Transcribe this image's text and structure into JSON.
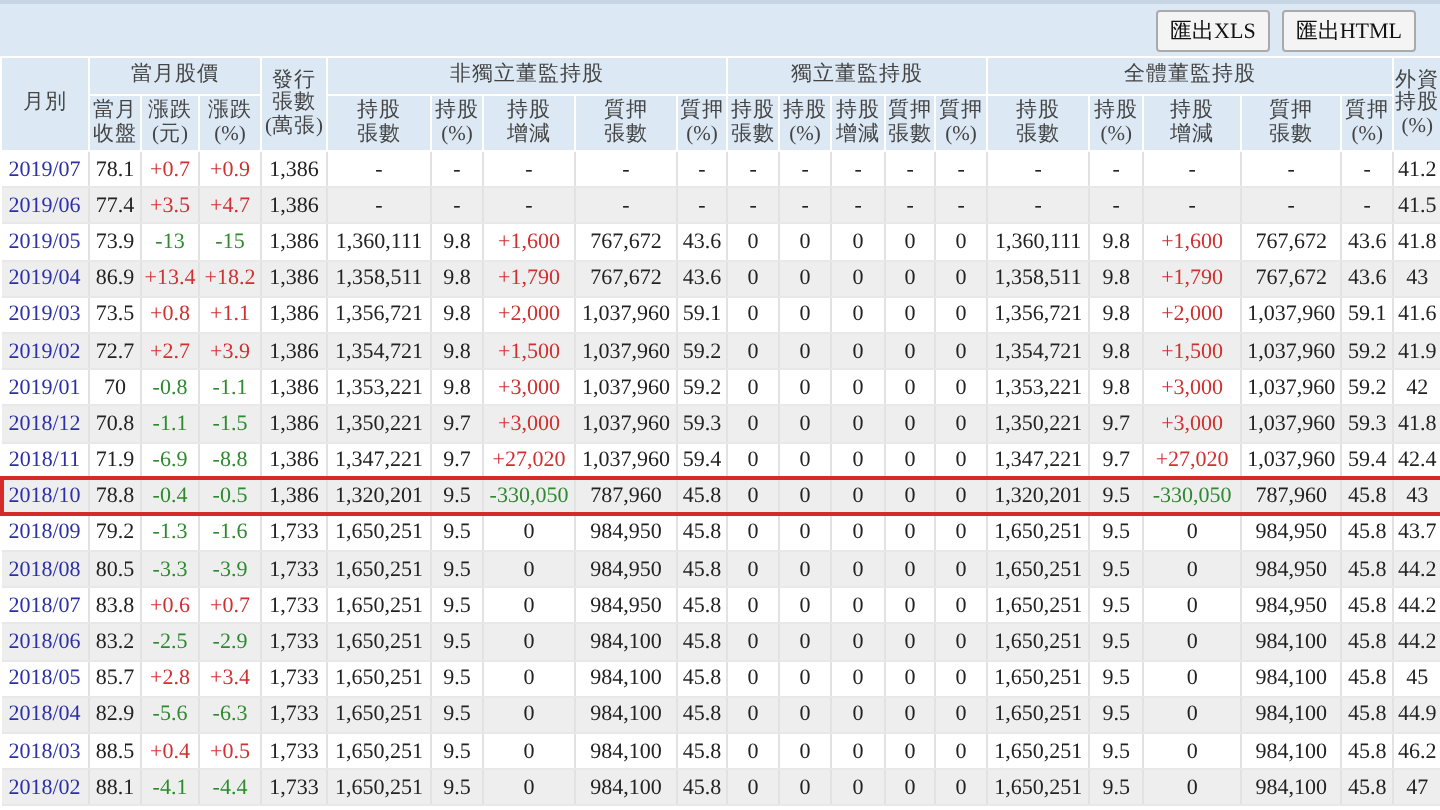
{
  "toolbar": {
    "buttons": [
      "匯出XLS",
      "匯出HTML"
    ]
  },
  "header": [
    {
      "kind": "single",
      "label": "月別"
    },
    {
      "kind": "group",
      "label": "當月股價",
      "columns": [
        "當月收盤",
        "漲跌(元)",
        "漲跌(%)"
      ]
    },
    {
      "kind": "single",
      "label": "發行張數(萬張)"
    },
    {
      "kind": "group",
      "label": "非獨立董監持股",
      "columns": [
        "持股張數",
        "持股(%)",
        "持股增減",
        "質押張數",
        "質押(%)"
      ]
    },
    {
      "kind": "group",
      "label": "獨立董監持股",
      "columns": [
        "持股張數",
        "持股(%)",
        "持股增減",
        "質押張數",
        "質押(%)"
      ]
    },
    {
      "kind": "group",
      "label": "全體董監持股",
      "columns": [
        "持股張數",
        "持股(%)",
        "持股增減",
        "質押張數",
        "質押(%)"
      ]
    },
    {
      "kind": "single",
      "label": "外資持股(%)"
    }
  ],
  "rows": [
    {
      "month": "2019/07",
      "price_rise": true,
      "holding_rise": false,
      "holding_fall": false,
      "highlighted": false,
      "cells": [
        "78.1",
        "+0.7",
        "+0.9",
        "1,386",
        "-",
        "-",
        "-",
        "-",
        "-",
        "-",
        "-",
        "-",
        "-",
        "-",
        "-",
        "-",
        "-",
        "-",
        "-",
        "41.2"
      ]
    },
    {
      "month": "2019/06",
      "price_rise": true,
      "holding_rise": false,
      "holding_fall": false,
      "highlighted": false,
      "cells": [
        "77.4",
        "+3.5",
        "+4.7",
        "1,386",
        "-",
        "-",
        "-",
        "-",
        "-",
        "-",
        "-",
        "-",
        "-",
        "-",
        "-",
        "-",
        "-",
        "-",
        "-",
        "41.5"
      ]
    },
    {
      "month": "2019/05",
      "price_rise": false,
      "holding_rise": true,
      "highlighted": false,
      "cells": [
        "73.9",
        "-13",
        "-15",
        "1,386",
        "1,360,111",
        "9.8",
        "+1,600",
        "767,672",
        "43.6",
        "0",
        "0",
        "0",
        "0",
        "0",
        "1,360,111",
        "9.8",
        "+1,600",
        "767,672",
        "43.6",
        "41.8"
      ]
    },
    {
      "month": "2019/04",
      "price_rise": true,
      "holding_rise": true,
      "highlighted": false,
      "cells": [
        "86.9",
        "+13.4",
        "+18.2",
        "1,386",
        "1,358,511",
        "9.8",
        "+1,790",
        "767,672",
        "43.6",
        "0",
        "0",
        "0",
        "0",
        "0",
        "1,358,511",
        "9.8",
        "+1,790",
        "767,672",
        "43.6",
        "43"
      ]
    },
    {
      "month": "2019/03",
      "price_rise": true,
      "holding_rise": true,
      "highlighted": false,
      "cells": [
        "73.5",
        "+0.8",
        "+1.1",
        "1,386",
        "1,356,721",
        "9.8",
        "+2,000",
        "1,037,960",
        "59.1",
        "0",
        "0",
        "0",
        "0",
        "0",
        "1,356,721",
        "9.8",
        "+2,000",
        "1,037,960",
        "59.1",
        "41.6"
      ]
    },
    {
      "month": "2019/02",
      "price_rise": true,
      "holding_rise": true,
      "highlighted": false,
      "cells": [
        "72.7",
        "+2.7",
        "+3.9",
        "1,386",
        "1,354,721",
        "9.8",
        "+1,500",
        "1,037,960",
        "59.2",
        "0",
        "0",
        "0",
        "0",
        "0",
        "1,354,721",
        "9.8",
        "+1,500",
        "1,037,960",
        "59.2",
        "41.9"
      ]
    },
    {
      "month": "2019/01",
      "price_rise": false,
      "holding_rise": true,
      "highlighted": false,
      "cells": [
        "70",
        "-0.8",
        "-1.1",
        "1,386",
        "1,353,221",
        "9.8",
        "+3,000",
        "1,037,960",
        "59.2",
        "0",
        "0",
        "0",
        "0",
        "0",
        "1,353,221",
        "9.8",
        "+3,000",
        "1,037,960",
        "59.2",
        "42"
      ]
    },
    {
      "month": "2018/12",
      "price_rise": false,
      "holding_rise": true,
      "highlighted": false,
      "cells": [
        "70.8",
        "-1.1",
        "-1.5",
        "1,386",
        "1,350,221",
        "9.7",
        "+3,000",
        "1,037,960",
        "59.3",
        "0",
        "0",
        "0",
        "0",
        "0",
        "1,350,221",
        "9.7",
        "+3,000",
        "1,037,960",
        "59.3",
        "41.8"
      ]
    },
    {
      "month": "2018/11",
      "price_rise": false,
      "holding_rise": true,
      "highlighted": false,
      "cells": [
        "71.9",
        "-6.9",
        "-8.8",
        "1,386",
        "1,347,221",
        "9.7",
        "+27,020",
        "1,037,960",
        "59.4",
        "0",
        "0",
        "0",
        "0",
        "0",
        "1,347,221",
        "9.7",
        "+27,020",
        "1,037,960",
        "59.4",
        "42.4"
      ]
    },
    {
      "month": "2018/10",
      "price_rise": false,
      "holding_rise": false,
      "holding_fall": true,
      "highlighted": true,
      "cells": [
        "78.8",
        "-0.4",
        "-0.5",
        "1,386",
        "1,320,201",
        "9.5",
        "-330,050",
        "787,960",
        "45.8",
        "0",
        "0",
        "0",
        "0",
        "0",
        "1,320,201",
        "9.5",
        "-330,050",
        "787,960",
        "45.8",
        "43"
      ]
    },
    {
      "month": "2018/09",
      "price_rise": false,
      "holding_rise": false,
      "holding_fall": false,
      "highlighted": false,
      "cells": [
        "79.2",
        "-1.3",
        "-1.6",
        "1,733",
        "1,650,251",
        "9.5",
        "0",
        "984,950",
        "45.8",
        "0",
        "0",
        "0",
        "0",
        "0",
        "1,650,251",
        "9.5",
        "0",
        "984,950",
        "45.8",
        "43.7"
      ]
    },
    {
      "month": "2018/08",
      "price_rise": false,
      "holding_rise": false,
      "holding_fall": false,
      "highlighted": false,
      "cells": [
        "80.5",
        "-3.3",
        "-3.9",
        "1,733",
        "1,650,251",
        "9.5",
        "0",
        "984,950",
        "45.8",
        "0",
        "0",
        "0",
        "0",
        "0",
        "1,650,251",
        "9.5",
        "0",
        "984,950",
        "45.8",
        "44.2"
      ]
    },
    {
      "month": "2018/07",
      "price_rise": true,
      "holding_rise": false,
      "holding_fall": false,
      "highlighted": false,
      "cells": [
        "83.8",
        "+0.6",
        "+0.7",
        "1,733",
        "1,650,251",
        "9.5",
        "0",
        "984,950",
        "45.8",
        "0",
        "0",
        "0",
        "0",
        "0",
        "1,650,251",
        "9.5",
        "0",
        "984,950",
        "45.8",
        "44.2"
      ]
    },
    {
      "month": "2018/06",
      "price_rise": false,
      "holding_rise": false,
      "holding_fall": false,
      "highlighted": false,
      "cells": [
        "83.2",
        "-2.5",
        "-2.9",
        "1,733",
        "1,650,251",
        "9.5",
        "0",
        "984,100",
        "45.8",
        "0",
        "0",
        "0",
        "0",
        "0",
        "1,650,251",
        "9.5",
        "0",
        "984,100",
        "45.8",
        "44.2"
      ]
    },
    {
      "month": "2018/05",
      "price_rise": true,
      "holding_rise": false,
      "holding_fall": false,
      "highlighted": false,
      "cells": [
        "85.7",
        "+2.8",
        "+3.4",
        "1,733",
        "1,650,251",
        "9.5",
        "0",
        "984,100",
        "45.8",
        "0",
        "0",
        "0",
        "0",
        "0",
        "1,650,251",
        "9.5",
        "0",
        "984,100",
        "45.8",
        "45"
      ]
    },
    {
      "month": "2018/04",
      "price_rise": false,
      "holding_rise": false,
      "holding_fall": false,
      "highlighted": false,
      "cells": [
        "82.9",
        "-5.6",
        "-6.3",
        "1,733",
        "1,650,251",
        "9.5",
        "0",
        "984,100",
        "45.8",
        "0",
        "0",
        "0",
        "0",
        "0",
        "1,650,251",
        "9.5",
        "0",
        "984,100",
        "45.8",
        "44.9"
      ]
    },
    {
      "month": "2018/03",
      "price_rise": true,
      "holding_rise": false,
      "holding_fall": false,
      "highlighted": false,
      "cells": [
        "88.5",
        "+0.4",
        "+0.5",
        "1,733",
        "1,650,251",
        "9.5",
        "0",
        "984,100",
        "45.8",
        "0",
        "0",
        "0",
        "0",
        "0",
        "1,650,251",
        "9.5",
        "0",
        "984,100",
        "45.8",
        "46.2"
      ]
    },
    {
      "month": "2018/02",
      "price_rise": false,
      "holding_rise": false,
      "holding_fall": false,
      "highlighted": false,
      "cells": [
        "88.1",
        "-4.1",
        "-4.4",
        "1,733",
        "1,650,251",
        "9.5",
        "0",
        "984,100",
        "45.8",
        "0",
        "0",
        "0",
        "0",
        "0",
        "1,650,251",
        "9.5",
        "0",
        "984,100",
        "45.8",
        "47"
      ]
    }
  ]
}
